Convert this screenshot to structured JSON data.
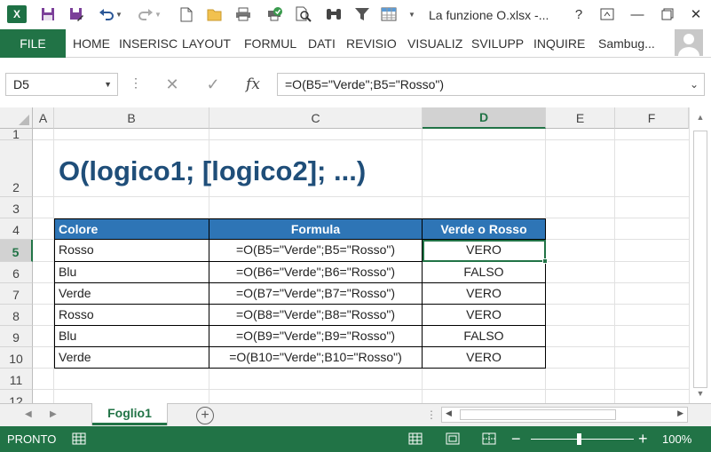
{
  "window": {
    "title": "La funzione O.xlsx -...",
    "app_icon_label": "X",
    "help": "?",
    "minimize": "—",
    "close": "✕"
  },
  "ribbon": {
    "file": "FILE",
    "tabs": [
      "HOME",
      "INSERISC",
      "LAYOUT",
      "FORMUL",
      "DATI",
      "REVISIO",
      "VISUALIZ",
      "SVILUPP",
      "INQUIRE"
    ],
    "user": "Sambug..."
  },
  "formula_bar": {
    "name_box": "D5",
    "formula": "=O(B5=\"Verde\";B5=\"Rosso\")",
    "fx": "fx"
  },
  "grid": {
    "columns": [
      "A",
      "B",
      "C",
      "D",
      "E",
      "F"
    ],
    "rows": [
      "1",
      "2",
      "3",
      "4",
      "5",
      "6",
      "7",
      "8",
      "9",
      "10",
      "11",
      "12"
    ],
    "selected_column": "D",
    "selected_row": "5"
  },
  "sheet": {
    "heading": "O(logico1; [logico2]; ...)",
    "table": {
      "headers": [
        "Colore",
        "Formula",
        "Verde o Rosso"
      ],
      "rows": [
        [
          "Rosso",
          "=O(B5=\"Verde\";B5=\"Rosso\")",
          "VERO"
        ],
        [
          "Blu",
          "=O(B6=\"Verde\";B6=\"Rosso\")",
          "FALSO"
        ],
        [
          "Verde",
          "=O(B7=\"Verde\";B7=\"Rosso\")",
          "VERO"
        ],
        [
          "Rosso",
          "=O(B8=\"Verde\";B8=\"Rosso\")",
          "VERO"
        ],
        [
          "Blu",
          "=O(B9=\"Verde\";B9=\"Rosso\")",
          "FALSO"
        ],
        [
          "Verde",
          "=O(B10=\"Verde\";B10=\"Rosso\")",
          "VERO"
        ]
      ]
    }
  },
  "sheet_tabs": {
    "active": "Foglio1",
    "add": "+"
  },
  "status": {
    "mode": "PRONTO",
    "zoom": "100%",
    "zoom_minus": "−",
    "zoom_plus": "+"
  },
  "colors": {
    "excel_green": "#217346",
    "header_blue": "#2e75b6",
    "heading_blue": "#1f4e79"
  }
}
